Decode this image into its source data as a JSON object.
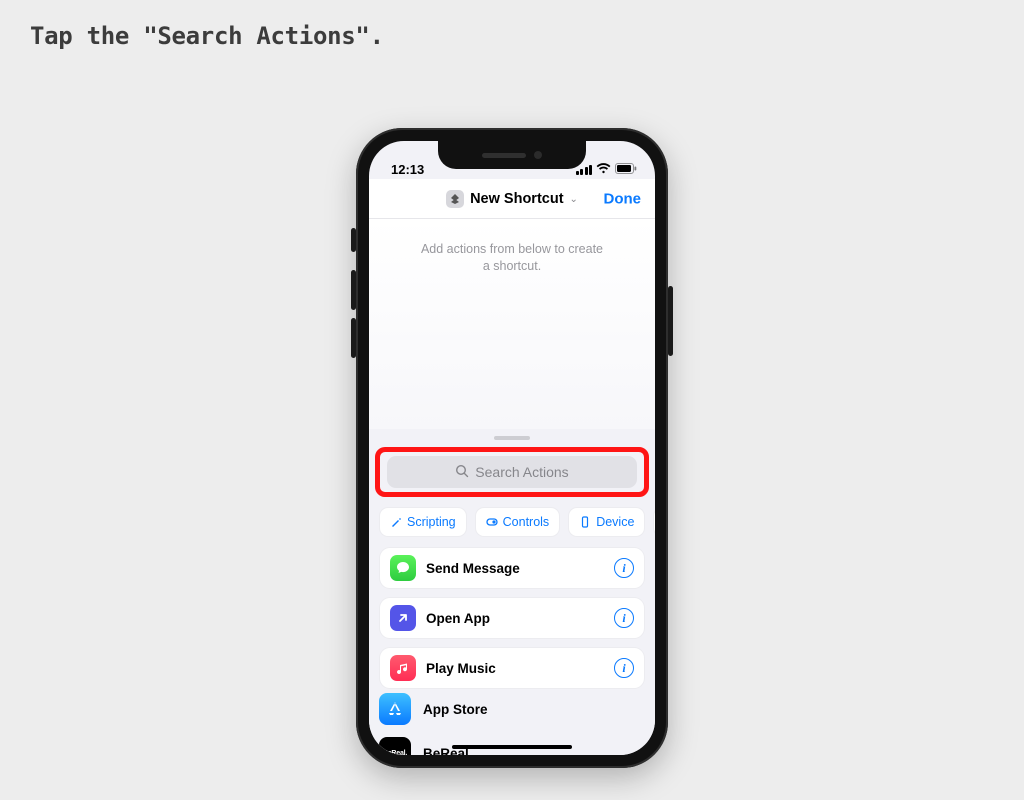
{
  "instruction": "Tap the \"Search Actions\".",
  "status": {
    "time": "12:13"
  },
  "header": {
    "title": "New Shortcut",
    "done": "Done"
  },
  "canvas": {
    "hint_line1": "Add actions from below to create",
    "hint_line2": "a shortcut."
  },
  "search": {
    "placeholder": "Search Actions"
  },
  "chips": [
    {
      "label": "Scripting"
    },
    {
      "label": "Controls"
    },
    {
      "label": "Device"
    }
  ],
  "actions": [
    {
      "label": "Send Message"
    },
    {
      "label": "Open App"
    },
    {
      "label": "Play Music"
    }
  ],
  "apps": [
    {
      "label": "App Store"
    },
    {
      "label": "BeReal."
    }
  ]
}
